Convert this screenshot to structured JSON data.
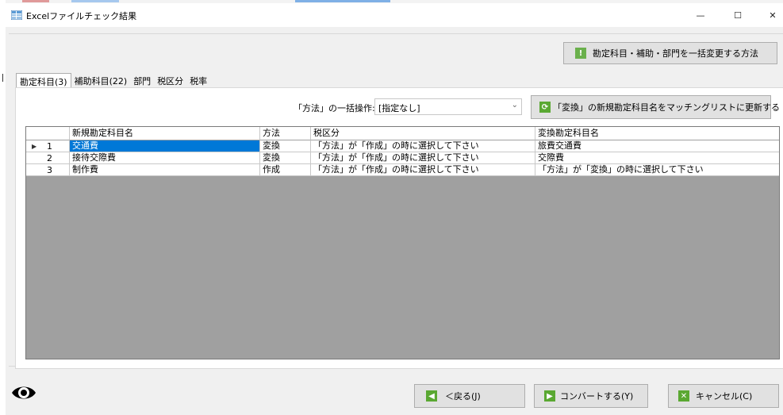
{
  "window": {
    "title": "Excelファイルチェック結果",
    "minimize_glyph": "—",
    "maximize_glyph": "☐",
    "close_glyph": "✕"
  },
  "toolbar": {
    "bulk_help_label": "勘定科目・補助・部門を一括変更する方法",
    "update_label": "「変換」の新規勘定科目名をマッチングリストに更新する"
  },
  "tabs": [
    {
      "label": "勘定科目(3)",
      "active": true
    },
    {
      "label": "補助科目(22)",
      "active": false
    },
    {
      "label": "部門",
      "active": false
    },
    {
      "label": "税区分",
      "active": false
    },
    {
      "label": "税率",
      "active": false
    }
  ],
  "bulk_operation": {
    "label": "「方法」の一括操作:",
    "selected": "[指定なし]"
  },
  "grid": {
    "headers": [
      "",
      "新規勘定科目名",
      "方法",
      "税区分",
      "変換勘定科目名"
    ],
    "rows": [
      {
        "num": "1",
        "name": "交通費",
        "method": "変換",
        "tax": "「方法」が「作成」の時に選択して下さい",
        "target": "旅費交通費",
        "current": true
      },
      {
        "num": "2",
        "name": "接待交際費",
        "method": "変換",
        "tax": "「方法」が「作成」の時に選択して下さい",
        "target": "交際費",
        "current": false
      },
      {
        "num": "3",
        "name": "制作費",
        "method": "作成",
        "tax": "「方法」が「作成」の時に選択して下さい",
        "target": "「方法」が「変換」の時に選択して下さい",
        "current": false
      }
    ]
  },
  "footer": {
    "back_label": "＜戻る(J)",
    "convert_label": "コンバートする(Y)",
    "cancel_label": "キャンセル(C)"
  },
  "icons": {
    "app": "spreadsheet-app-icon",
    "help": "exclamation-icon",
    "update": "refresh-icon",
    "back": "arrow-left-icon",
    "convert": "arrow-right-icon",
    "cancel": "x-icon",
    "eye": "eye-icon"
  },
  "colors": {
    "selection": "#0078d7",
    "grid_background": "#a0a0a0",
    "icon_green": "#5aa832"
  }
}
